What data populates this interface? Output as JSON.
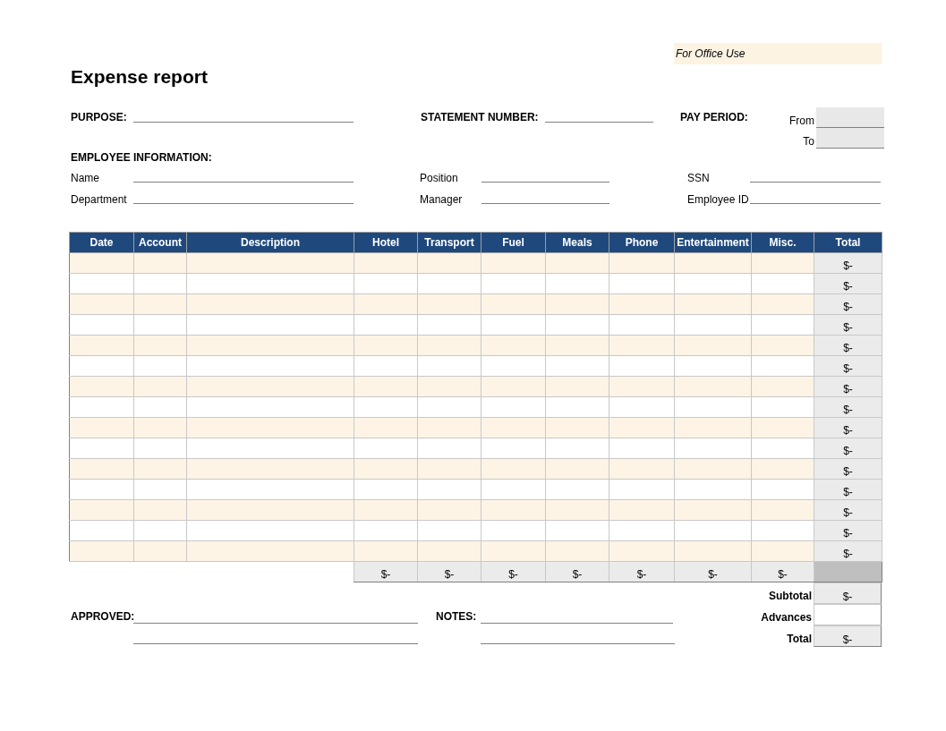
{
  "office_use": "For Office Use",
  "title": "Expense report",
  "purpose": {
    "label": "PURPOSE:"
  },
  "statement_number": {
    "label": "STATEMENT NUMBER:"
  },
  "pay_period": {
    "label": "PAY PERIOD:",
    "from_label": "From",
    "to_label": "To"
  },
  "employee_information": {
    "heading": "EMPLOYEE INFORMATION:",
    "fields": [
      {
        "label": "Name"
      },
      {
        "label": "Position"
      },
      {
        "label": "SSN"
      },
      {
        "label": "Department"
      },
      {
        "label": "Manager"
      },
      {
        "label": "Employee ID"
      }
    ]
  },
  "table": {
    "columns": [
      "Date",
      "Account",
      "Description",
      "Hotel",
      "Transport",
      "Fuel",
      "Meals",
      "Phone",
      "Entertainment",
      "Misc.",
      "Total"
    ],
    "rows": [
      {
        "total": "$-"
      },
      {
        "total": "$-"
      },
      {
        "total": "$-"
      },
      {
        "total": "$-"
      },
      {
        "total": "$-"
      },
      {
        "total": "$-"
      },
      {
        "total": "$-"
      },
      {
        "total": "$-"
      },
      {
        "total": "$-"
      },
      {
        "total": "$-"
      },
      {
        "total": "$-"
      },
      {
        "total": "$-"
      },
      {
        "total": "$-"
      },
      {
        "total": "$-"
      },
      {
        "total": "$-"
      }
    ],
    "column_totals": [
      "$-",
      "$-",
      "$-",
      "$-",
      "$-",
      "$-",
      "$-"
    ]
  },
  "approved": {
    "label": "APPROVED:"
  },
  "notes": {
    "label": "NOTES:"
  },
  "summary": [
    {
      "label": "Subtotal",
      "value": "$-",
      "kind": "computed"
    },
    {
      "label": "Advances",
      "kind": "input"
    },
    {
      "label": "Total",
      "value": "$-",
      "kind": "computed"
    }
  ]
}
